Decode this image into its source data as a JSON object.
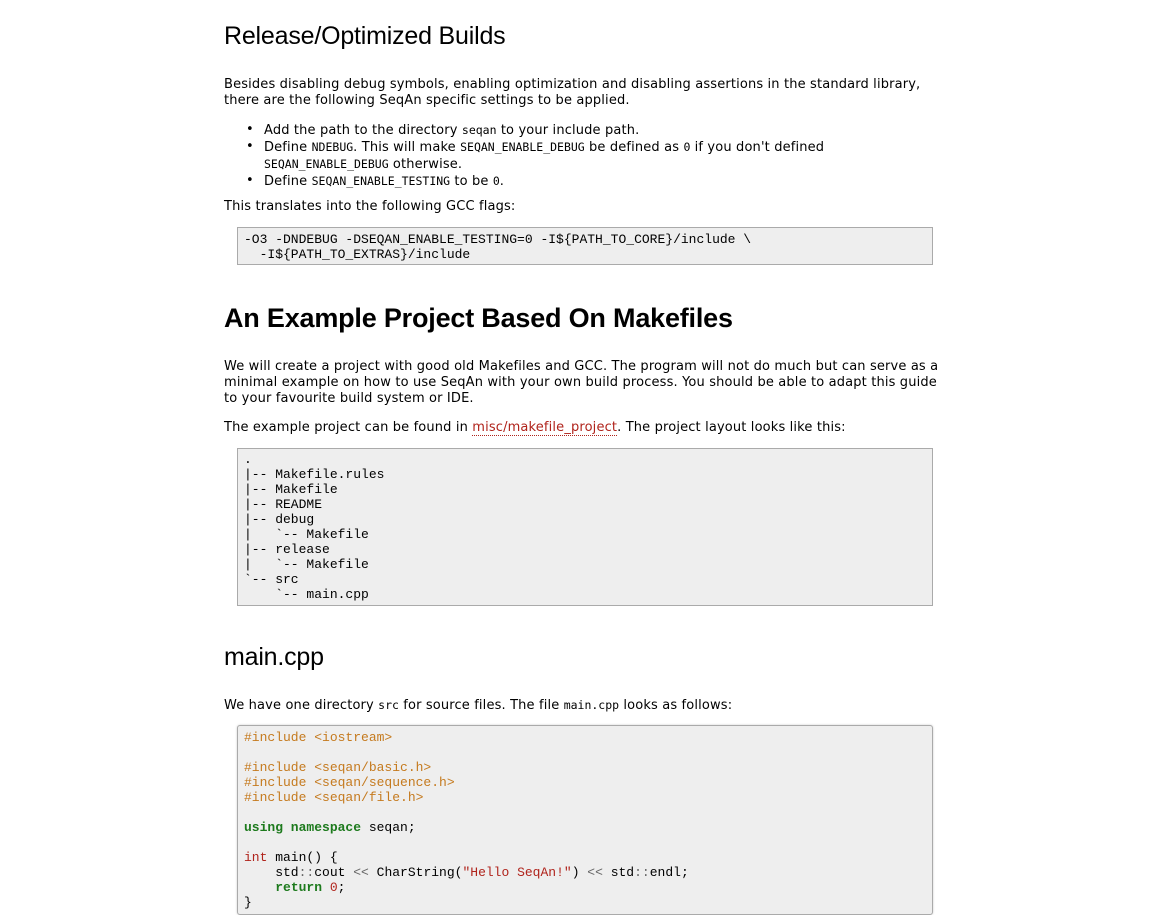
{
  "section1": {
    "title": "Release/Optimized Builds",
    "intro_line1": "Besides disabling debug symbols, enabling optimization and disabling assertions in the standard library,",
    "intro_line2": "there are the following SeqAn specific settings to be applied.",
    "bullets": {
      "b1_pre": "Add the path to the directory ",
      "b1_code": "seqan",
      "b1_post": " to your include path.",
      "b2_pre": "Define ",
      "b2_code1": "NDEBUG",
      "b2_mid1": ". This will make ",
      "b2_code2": "SEQAN_ENABLE_DEBUG",
      "b2_mid2": " be defined as ",
      "b2_code3": "0",
      "b2_mid3": " if you don't defined",
      "b2_code4": "SEQAN_ENABLE_DEBUG",
      "b2_post": " otherwise.",
      "b3_pre": "Define ",
      "b3_code1": "SEQAN_ENABLE_TESTING",
      "b3_mid": " to be ",
      "b3_code2": "0",
      "b3_post": "."
    },
    "translate_text": "This translates into the following GCC flags:",
    "gcc_flags": "-O3 -DNDEBUG -DSEQAN_ENABLE_TESTING=0 -I${PATH_TO_CORE}/include \\\n  -I${PATH_TO_EXTRAS}/include"
  },
  "section2": {
    "title": "An Example Project Based On Makefiles",
    "para_line1": "We will create a project with good old Makefiles and GCC. The program will not do much but can serve as a",
    "para_line2": "minimal example on how to use SeqAn with your own build process. You should be able to adapt this guide",
    "para_line3": "to your favourite build system or IDE.",
    "found_pre": "The example project can be found in ",
    "found_link": "misc/makefile_project",
    "found_post": ". The project layout looks like this:",
    "tree": ".\n|-- Makefile.rules\n|-- Makefile\n|-- README\n|-- debug\n|   `-- Makefile\n|-- release\n|   `-- Makefile\n`-- src\n    `-- main.cpp"
  },
  "section3": {
    "title": "main.cpp",
    "para_pre": "We have one directory ",
    "para_code1": "src",
    "para_mid": " for source files. The file ",
    "para_code2": "main.cpp",
    "para_post": " looks as follows:",
    "code": {
      "inc1": "#include <iostream>",
      "inc2": "#include <seqan/basic.h>",
      "inc3": "#include <seqan/sequence.h>",
      "inc4": "#include <seqan/file.h>",
      "using_kw": "using namespace",
      "using_rest": " seqan;",
      "int_kw": "int",
      "main_rest": " main() {",
      "cout_pre": "    std",
      "cout_sep1": "::",
      "cout_mid": "cout ",
      "cout_op1": "<<",
      "cout_cs": " CharString(",
      "cout_str": "\"Hello SeqAn!\"",
      "cout_close": ") ",
      "cout_op2": "<<",
      "cout_std": " std",
      "cout_sep2": "::",
      "cout_endl": "endl;",
      "ret_indent": "    ",
      "ret_kw": "return",
      "ret_num": " 0",
      "ret_end": ";",
      "close": "}"
    }
  }
}
